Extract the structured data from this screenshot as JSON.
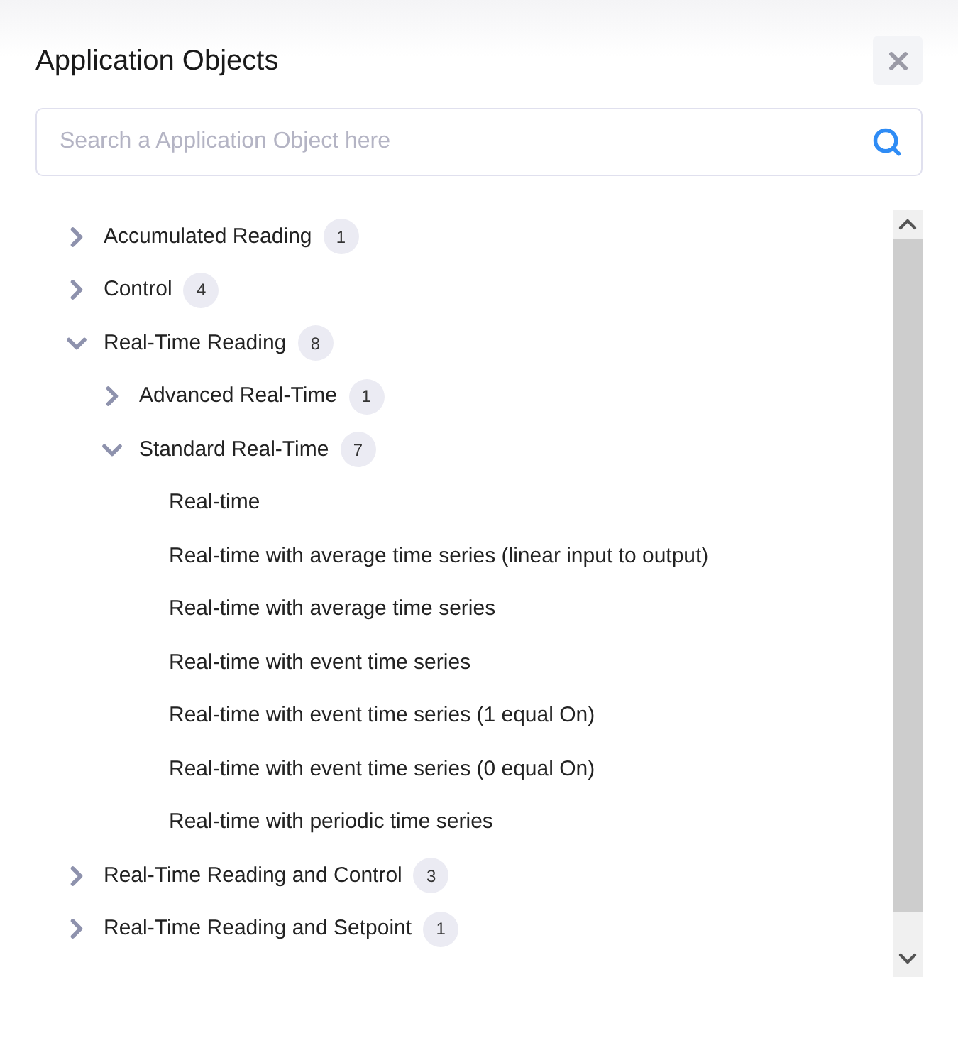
{
  "dialog": {
    "title": "Application Objects"
  },
  "search": {
    "placeholder": "Search a Application Object here"
  },
  "tree": [
    {
      "label": "Accumulated Reading",
      "count": "1",
      "expanded": false
    },
    {
      "label": "Control",
      "count": "4",
      "expanded": false
    },
    {
      "label": "Real-Time Reading",
      "count": "8",
      "expanded": true,
      "children": [
        {
          "label": "Advanced Real-Time",
          "count": "1",
          "expanded": false
        },
        {
          "label": "Standard Real-Time",
          "count": "7",
          "expanded": true,
          "children": [
            {
              "label": "Real-time"
            },
            {
              "label": "Real-time with average time series (linear input to output)"
            },
            {
              "label": "Real-time with average time series"
            },
            {
              "label": "Real-time with event time series"
            },
            {
              "label": "Real-time with event time series (1 equal On)"
            },
            {
              "label": "Real-time with event time series (0 equal On)"
            },
            {
              "label": "Real-time with periodic time series"
            }
          ]
        }
      ]
    },
    {
      "label": "Real-Time Reading and Control",
      "count": "3",
      "expanded": false
    },
    {
      "label": "Real-Time Reading and Setpoint",
      "count": "1",
      "expanded": false
    }
  ]
}
